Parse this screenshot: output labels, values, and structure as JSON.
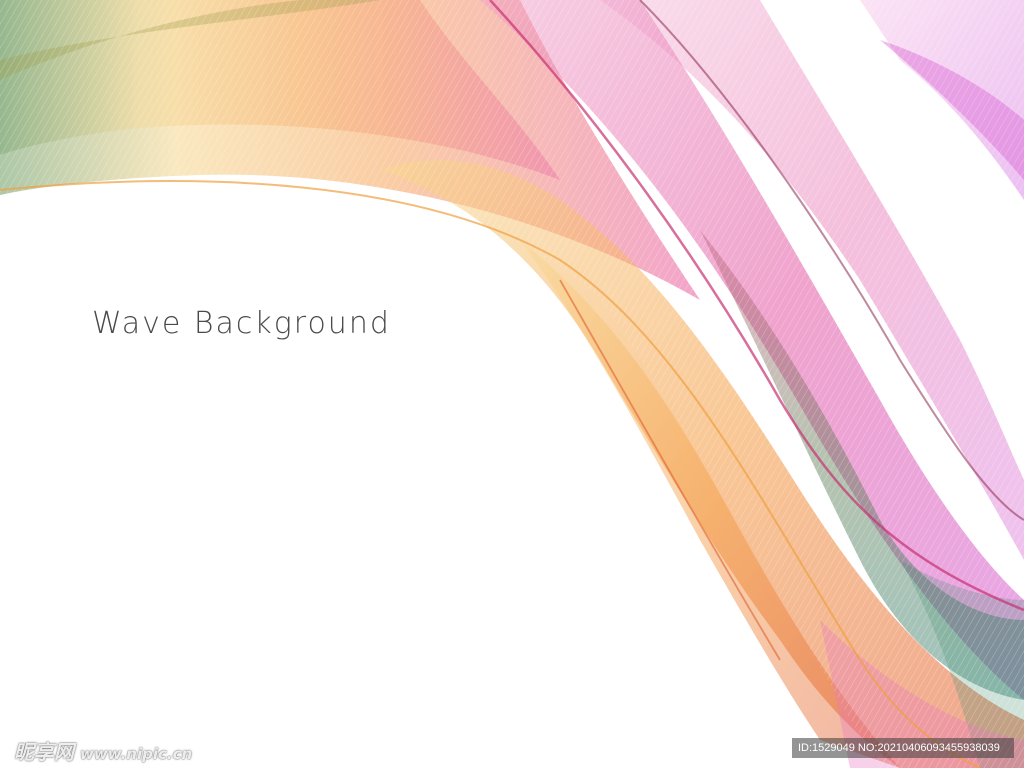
{
  "headline": "Wave Background",
  "watermark": {
    "logo_text": "昵享网",
    "url_text": "www.nipic.cn",
    "id_text": "ID:1529049 NO:20210406093455938039"
  },
  "colors": {
    "pink": "#e8489a",
    "magenta": "#d040c8",
    "orange": "#f39a3a",
    "yellow": "#f8d070",
    "green": "#3a8a6a",
    "red": "#e85a3a",
    "text": "#4a4a4a"
  }
}
